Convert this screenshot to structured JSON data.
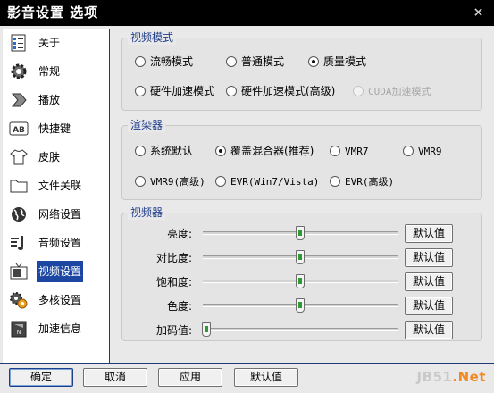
{
  "window": {
    "title": "影音设置 选项",
    "close_label": "×"
  },
  "sidebar": {
    "items": [
      {
        "label": "关于",
        "icon": "checklist-icon",
        "active": false
      },
      {
        "label": "常规",
        "icon": "gear-icon",
        "active": false
      },
      {
        "label": "播放",
        "icon": "play-arrow-icon",
        "active": false
      },
      {
        "label": "快捷键",
        "icon": "keyboard-key-icon",
        "active": false
      },
      {
        "label": "皮肤",
        "icon": "shirt-icon",
        "active": false
      },
      {
        "label": "文件关联",
        "icon": "folder-icon",
        "active": false
      },
      {
        "label": "网络设置",
        "icon": "globe-icon",
        "active": false
      },
      {
        "label": "音频设置",
        "icon": "audio-note-icon",
        "active": false
      },
      {
        "label": "视频设置",
        "icon": "tv-icon",
        "active": true
      },
      {
        "label": "多核设置",
        "icon": "multicore-gear-icon",
        "active": false
      },
      {
        "label": "加速信息",
        "icon": "speed-info-icon",
        "active": false
      }
    ]
  },
  "video_mode": {
    "legend": "视频模式",
    "options": [
      {
        "label": "流畅模式",
        "selected": false,
        "disabled": false
      },
      {
        "label": "普通模式",
        "selected": false,
        "disabled": false
      },
      {
        "label": "质量模式",
        "selected": true,
        "disabled": false
      },
      {
        "label": "硬件加速模式",
        "selected": false,
        "disabled": false
      },
      {
        "label": "硬件加速模式(高级)",
        "selected": false,
        "disabled": false
      },
      {
        "label": "CUDA加速模式",
        "selected": false,
        "disabled": true
      }
    ]
  },
  "renderer": {
    "legend": "渲染器",
    "options": [
      {
        "label": "系统默认",
        "selected": false
      },
      {
        "label": "覆盖混合器(推荐)",
        "selected": true
      },
      {
        "label": "VMR7",
        "selected": false
      },
      {
        "label": "VMR9",
        "selected": false
      },
      {
        "label": "VMR9(高级)",
        "selected": false
      },
      {
        "label": "EVR(Win7/Vista)",
        "selected": false
      },
      {
        "label": "EVR(高级)",
        "selected": false
      }
    ]
  },
  "video_adjust": {
    "legend": "视频器",
    "rows": [
      {
        "label": "亮度:",
        "value": 0.5,
        "button": "默认值"
      },
      {
        "label": "对比度:",
        "value": 0.5,
        "button": "默认值"
      },
      {
        "label": "饱和度:",
        "value": 0.5,
        "button": "默认值"
      },
      {
        "label": "色度:",
        "value": 0.5,
        "button": "默认值"
      },
      {
        "label": "加码值:",
        "value": 0.02,
        "button": "默认值"
      }
    ]
  },
  "footer": {
    "ok": "确定",
    "cancel": "取消",
    "apply": "应用",
    "defaults": "默认值"
  },
  "watermark": {
    "prefix": "JB51",
    "suffix": ".Net"
  },
  "colors": {
    "accent": "#1b47a3",
    "legend": "#1d3c8a",
    "slider_thumb": "#2f9a34",
    "watermark": "#f08a24"
  }
}
